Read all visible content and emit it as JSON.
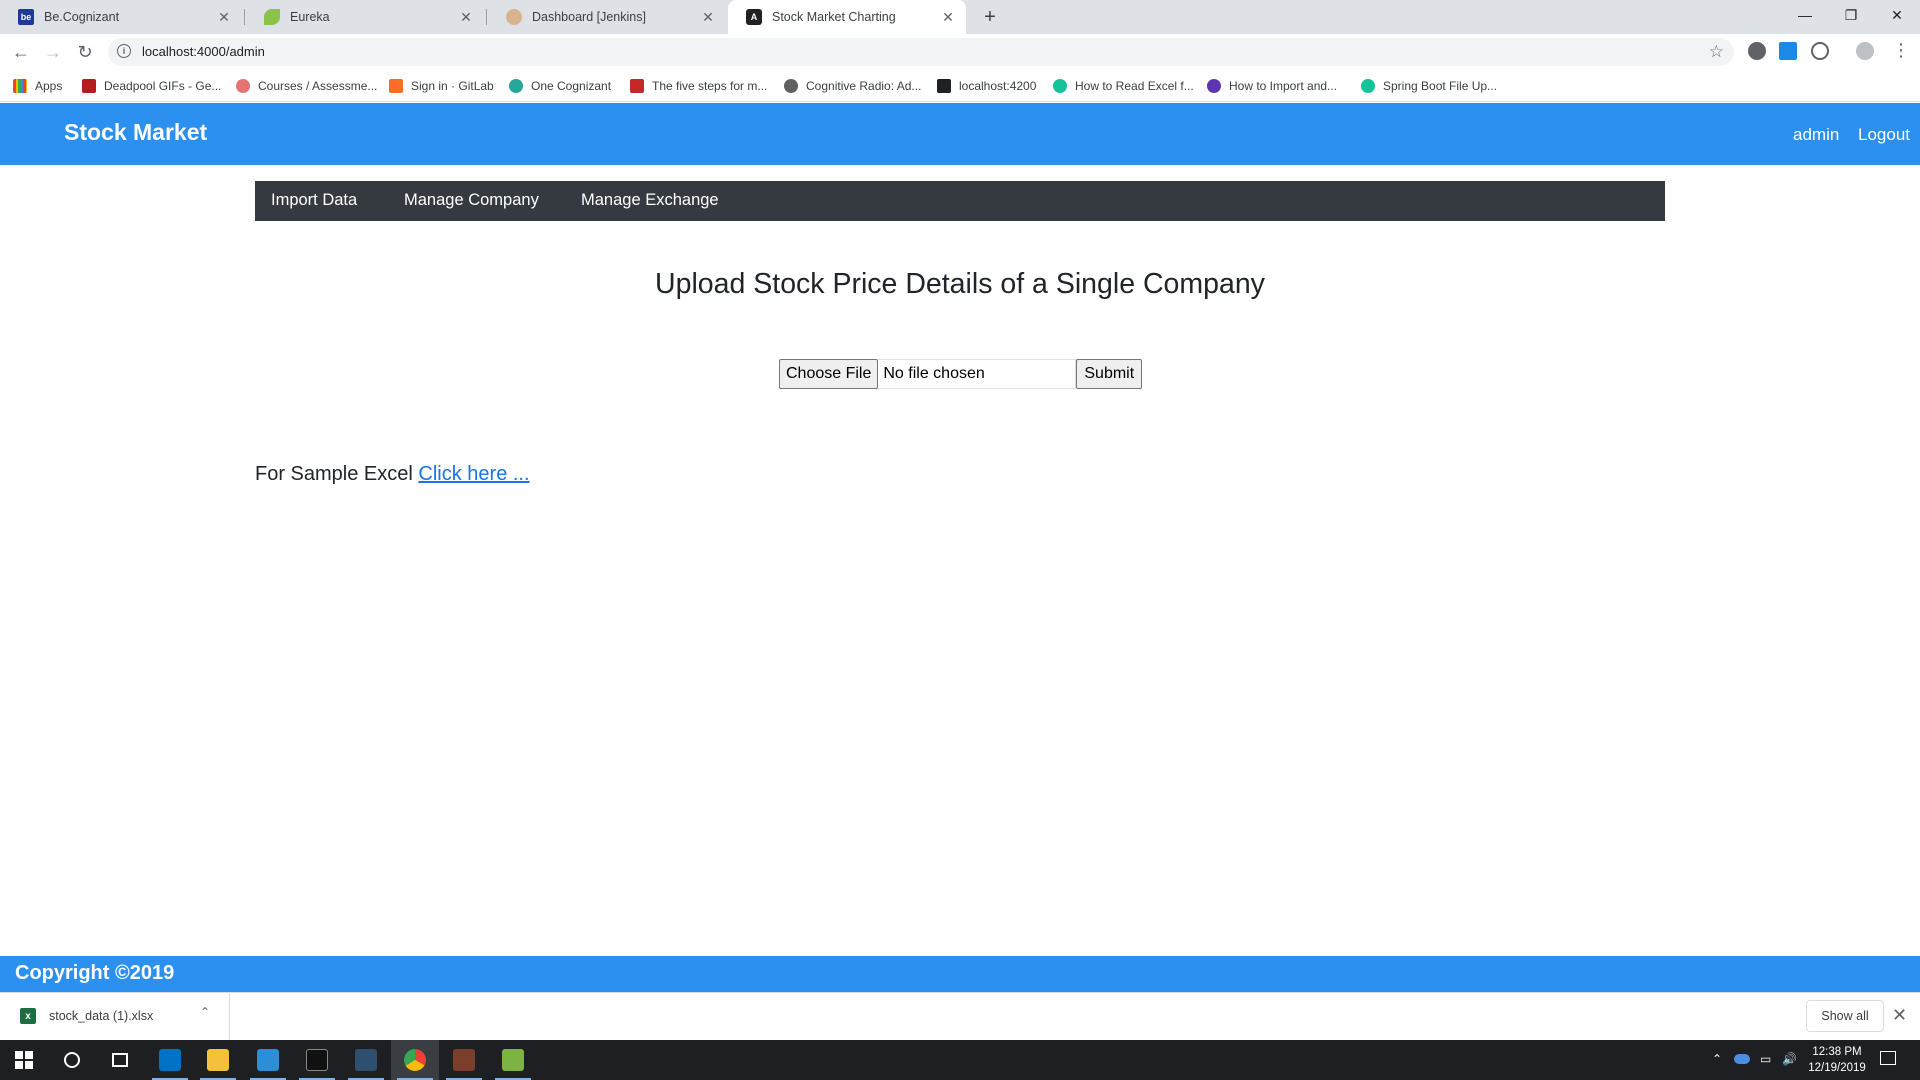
{
  "browser": {
    "tabs": [
      {
        "title": "Be.Cognizant",
        "icon": "be-cognizant-favicon",
        "active": false
      },
      {
        "title": "Eureka",
        "icon": "eureka-leaf-favicon",
        "active": false
      },
      {
        "title": "Dashboard [Jenkins]",
        "icon": "jenkins-favicon",
        "active": false
      },
      {
        "title": "Stock Market Charting",
        "icon": "angular-favicon",
        "active": true
      }
    ],
    "url": "localhost:4000/admin",
    "bookmarks": [
      {
        "label": "Apps",
        "icon": "apps-grid-icon"
      },
      {
        "label": "Deadpool GIFs - Ge...",
        "icon": "bookmark-favicon"
      },
      {
        "label": "Courses / Assessme...",
        "icon": "bookmark-favicon"
      },
      {
        "label": "Sign in · GitLab",
        "icon": "gitlab-favicon"
      },
      {
        "label": "One Cognizant",
        "icon": "bookmark-favicon"
      },
      {
        "label": "The five steps for m...",
        "icon": "bookmark-favicon"
      },
      {
        "label": "Cognitive Radio: Ad...",
        "icon": "bookmark-favicon"
      },
      {
        "label": "localhost:4200",
        "icon": "angular-favicon"
      },
      {
        "label": "How to Read Excel f...",
        "icon": "bookmark-favicon"
      },
      {
        "label": "How to Import and...",
        "icon": "bookmark-favicon"
      },
      {
        "label": "Spring Boot File Up...",
        "icon": "bookmark-favicon"
      }
    ]
  },
  "app": {
    "brand": "Stock Market",
    "user": "admin",
    "logout": "Logout",
    "nav": [
      "Import Data",
      "Manage Company",
      "Manage Exchange"
    ],
    "page_title": "Upload Stock Price Details of a Single Company",
    "upload": {
      "choose_label": "Choose File",
      "status": "No file chosen",
      "submit_label": "Submit"
    },
    "sample_prefix": "For Sample Excel",
    "sample_link": "Click here ...",
    "footer": "Copyright ©2019"
  },
  "downloads": {
    "file_name": "stock_data (1).xlsx",
    "show_all": "Show all"
  },
  "taskbar": {
    "time": "12:38 PM",
    "date": "12/19/2019"
  },
  "colors": {
    "header_blue": "#2b90ef",
    "subnav_dark": "#343a40",
    "link_blue": "#1a73e8"
  }
}
